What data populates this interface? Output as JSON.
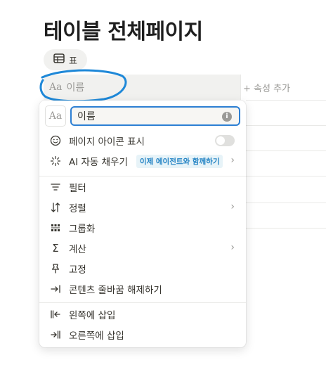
{
  "page": {
    "title": "테이블 전체페이지"
  },
  "view_tab": {
    "label": "표"
  },
  "table": {
    "header": {
      "name_label": "이름",
      "add_property": "+ 속성 추가"
    }
  },
  "menu": {
    "name_input": {
      "value": "이름"
    },
    "items": [
      {
        "label": "페이지 아이콘 표시"
      },
      {
        "label": "AI 자동 채우기",
        "badge": "이제 에이전트와 함께하기"
      },
      {
        "label": "필터"
      },
      {
        "label": "정렬"
      },
      {
        "label": "그룹화"
      },
      {
        "label": "계산"
      },
      {
        "label": "고정"
      },
      {
        "label": "콘텐츠 줄바꿈 해제하기"
      },
      {
        "label": "왼쪽에 삽입"
      },
      {
        "label": "오른쪽에 삽입"
      }
    ]
  },
  "colors": {
    "accent": "#2c7fd3",
    "annotation": "#1e88d8",
    "badge_bg": "#e7f3f8",
    "badge_text": "#2383c4"
  }
}
